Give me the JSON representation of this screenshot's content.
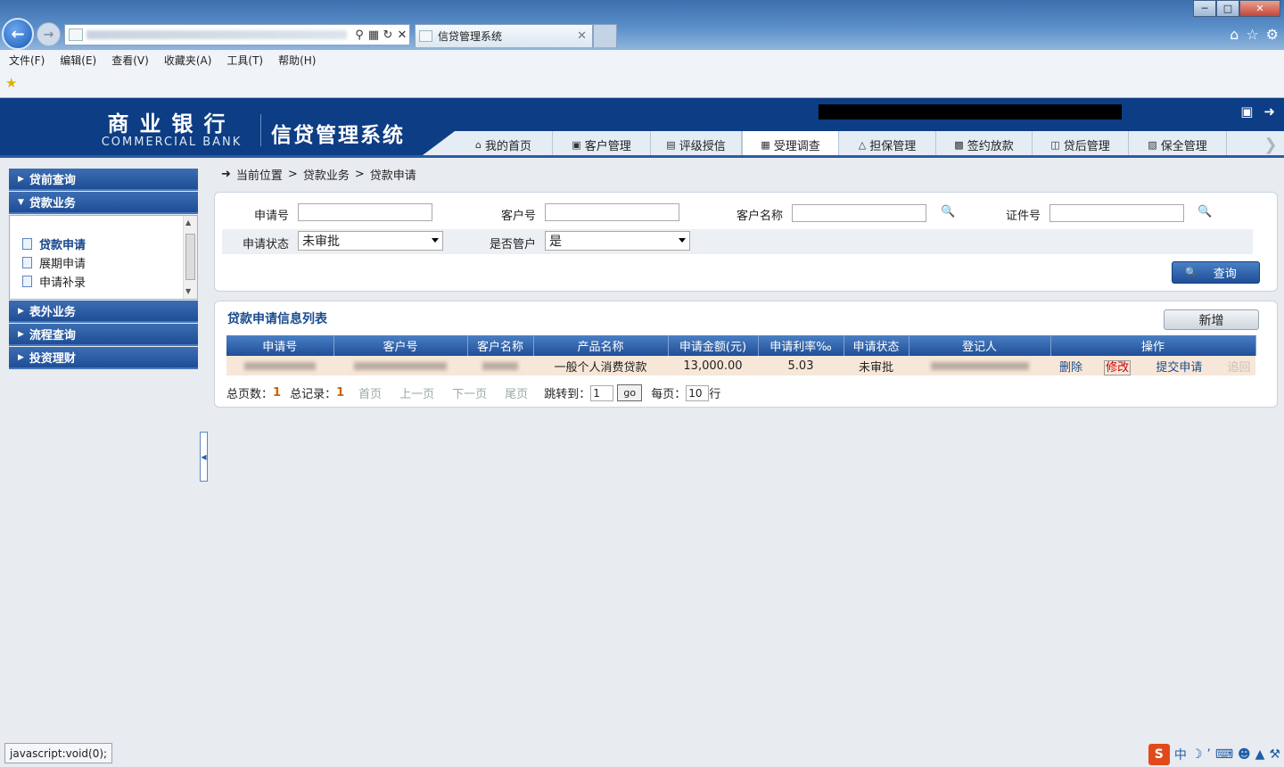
{
  "browser": {
    "tab_title": "信贷管理系统",
    "menu": [
      "文件(F)",
      "编辑(E)",
      "查看(V)",
      "收藏夹(A)",
      "工具(T)",
      "帮助(H)"
    ]
  },
  "header": {
    "bank_cn": "商业银行",
    "bank_en": "COMMERCIAL BANK",
    "system_name": "信贷管理系统",
    "nav_tabs": [
      {
        "label": "我的首页",
        "icon": "home-icon"
      },
      {
        "label": "客户管理",
        "icon": "customer-icon"
      },
      {
        "label": "评级授信",
        "icon": "rating-icon"
      },
      {
        "label": "受理调查",
        "icon": "survey-icon",
        "active": true
      },
      {
        "label": "担保管理",
        "icon": "guarantee-icon"
      },
      {
        "label": "签约放款",
        "icon": "contract-icon"
      },
      {
        "label": "贷后管理",
        "icon": "post-loan-icon"
      },
      {
        "label": "保全管理",
        "icon": "preservation-icon"
      }
    ]
  },
  "sidebar": {
    "groups": [
      "贷前查询",
      "贷款业务",
      "表外业务",
      "流程查询",
      "投资理财"
    ],
    "sub_items": [
      "贷款申请",
      "展期申请",
      "申请补录"
    ],
    "current": "贷款申请"
  },
  "breadcrumb": [
    "当前位置",
    "贷款业务",
    "贷款申请"
  ],
  "search": {
    "labels": {
      "apply_no": "申请号",
      "customer_no": "客户号",
      "customer_name": "客户名称",
      "id_no": "证件号",
      "apply_status": "申请状态",
      "is_manager": "是否管户"
    },
    "values": {
      "apply_no": "",
      "customer_no": "",
      "customer_name": "",
      "id_no": ""
    },
    "apply_status": "未审批",
    "is_manager": "是",
    "query_label": "查询"
  },
  "list": {
    "title": "贷款申请信息列表",
    "add_label": "新增",
    "columns": [
      "申请号",
      "客户号",
      "客户名称",
      "产品名称",
      "申请金额(元)",
      "申请利率‰",
      "申请状态",
      "登记人",
      "操作"
    ],
    "rows": [
      {
        "product": "一般个人消费贷款",
        "amount": "13,000.00",
        "rate": "5.03",
        "status": "未审批",
        "actions": [
          "删除",
          "修改",
          "提交申请",
          "追回"
        ]
      }
    ]
  },
  "pager": {
    "total_pages_label": "总页数：",
    "total_pages": "1",
    "total_records_label": "总记录：",
    "total_records": "1",
    "first": "首页",
    "prev": "上一页",
    "next": "下一页",
    "last": "尾页",
    "jump_label": "跳转到：",
    "jump_value": "1",
    "go": "go",
    "per_page_label": "每页：",
    "per_page": "10",
    "per_page_unit": "行"
  },
  "status_bar": "javascript:void(0);",
  "ime_label": "中"
}
